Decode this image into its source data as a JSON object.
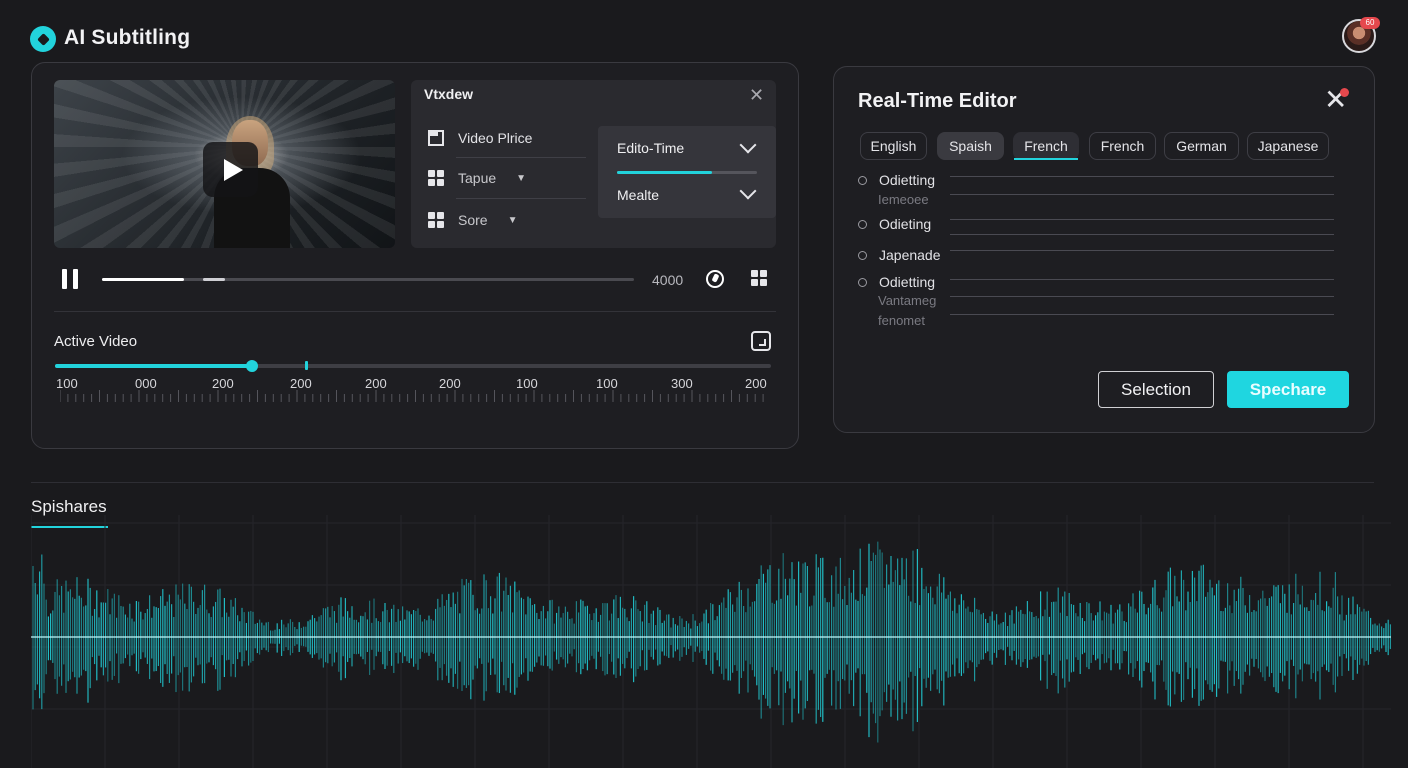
{
  "app": {
    "title": "AI Subtitling"
  },
  "user": {
    "badge": "60"
  },
  "video_panel": {
    "options": {
      "title": "Vtxdew",
      "items": [
        {
          "label": "Video Plrice",
          "icon": "panel-icon"
        },
        {
          "label": "Tapue",
          "icon": "grid-icon"
        },
        {
          "label": "Sore",
          "icon": "grid-icon"
        }
      ],
      "submenu": [
        {
          "label": "Edito-Time"
        },
        {
          "label": "Mealte"
        }
      ],
      "submenu_progress": 0.68
    },
    "player": {
      "time": "4000",
      "progress": 0.154,
      "buffer_end": 0.233
    },
    "active_video": {
      "label": "Active Video",
      "slider_value": 0.275,
      "ticks": [
        "100",
        "000",
        "200",
        "200",
        "200",
        "200",
        "100",
        "100",
        "300",
        "200"
      ]
    }
  },
  "editor": {
    "title": "Real-Time Editor",
    "languages": [
      {
        "label": "English",
        "state": "default"
      },
      {
        "label": "Spaish",
        "state": "selected"
      },
      {
        "label": "French",
        "state": "active"
      },
      {
        "label": "French",
        "state": "default"
      },
      {
        "label": "German",
        "state": "default"
      },
      {
        "label": "Japanese",
        "state": "default"
      }
    ],
    "subtitles": [
      {
        "label": "Odietting",
        "secondary": "Iemeoee"
      },
      {
        "label": "Odieting",
        "secondary": ""
      },
      {
        "label": "Japenade",
        "secondary": ""
      },
      {
        "label": "Odietting",
        "secondary": "Vantameg",
        "tertiary": "fenomet"
      }
    ],
    "buttons": {
      "selection": "Selection",
      "primary": "Spechare"
    }
  },
  "waveform": {
    "title": "Spishares",
    "color": "#22d3dc"
  },
  "colors": {
    "accent": "#22d3dc",
    "background": "#1a1a1d",
    "alert": "#e5484d"
  }
}
